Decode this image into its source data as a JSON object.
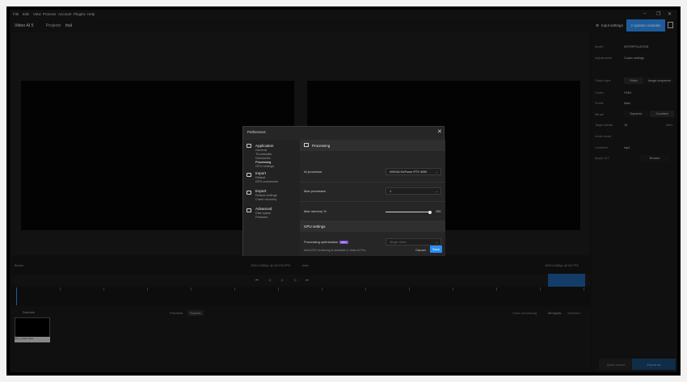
{
  "menubar": {
    "items": [
      "File",
      "Edit",
      "View",
      "Process",
      "Account",
      "Plugins",
      "Help"
    ]
  },
  "header": {
    "app_name": "Video AI 5",
    "breadcrumb": [
      "Projects",
      "trial"
    ],
    "input_settings_label": "Input settings",
    "updates_label": "2 updates available"
  },
  "sidebar": {
    "model_label": "Model",
    "model_value": "INTERPOLATION",
    "adjustments_label": "Adjustments",
    "adjustments_value": "Codec settings",
    "output_type_label": "Output type",
    "output_type_options": [
      "Video",
      "Image sequence"
    ],
    "codec_label": "Codec",
    "codec_value": "H264",
    "profile_label": "Profile",
    "profile_value": "Main",
    "bitrate_label": "Bitrate",
    "bitrate_options": [
      "Dynamic",
      "Constant"
    ],
    "target_bitrate_label": "Target bitrate",
    "target_bitrate_value": "15",
    "target_bitrate_unit": "Mb/s",
    "audio_label": "Audio mode",
    "container_label": "Container",
    "container_value": "mp4",
    "apply_lut_label": "Apply LUT",
    "browse_label": "Browse",
    "quick_export_label": "Quick export",
    "export_label": "Export as"
  },
  "viewer": {
    "before_label": "Before",
    "before_info": "1920×1080px @ 23.976 FPS",
    "after_label": "After",
    "after_info": "1920×1080px @ 60 FPS"
  },
  "sources": {
    "label": "Sources",
    "tabs": [
      "Previews",
      "Exports"
    ],
    "view_label": "Clear processing",
    "filter_all": "All inputs",
    "filter_selected": "Selected",
    "thumb_caption": "clip_1_test1.mp4"
  },
  "dialog": {
    "title": "Preferences",
    "nav": [
      {
        "heading": "Application",
        "items": [
          "General",
          "Thumbnails",
          "Directories",
          "Processing",
          "GPU settings"
        ]
      },
      {
        "heading": "Import",
        "items": [
          "Default",
          "GPU conversion"
        ]
      },
      {
        "heading": "Export",
        "items": [
          "Default settings",
          "Crash recovery"
        ]
      },
      {
        "heading": "Advanced",
        "items": [
          "Disk space",
          "Features"
        ]
      }
    ],
    "selected_item": "Processing",
    "section_processing": "Processing",
    "ai_processor_label": "AI processor",
    "ai_processor_value": "NVIDIA GeForce RTX 4090",
    "max_processes_label": "Max processes",
    "max_processes_value": "1",
    "max_memory_label": "Max memory %",
    "max_memory_value": "100",
    "section_gpu": "GPU settings",
    "processing_optimization_label": "Processing optimization",
    "pro_badge": "PRO",
    "processing_optimization_value": "Single video",
    "note": "Multi-GPU rendering is available in Video AI Pro.",
    "cancel_label": "Cancel",
    "save_label": "Save"
  }
}
